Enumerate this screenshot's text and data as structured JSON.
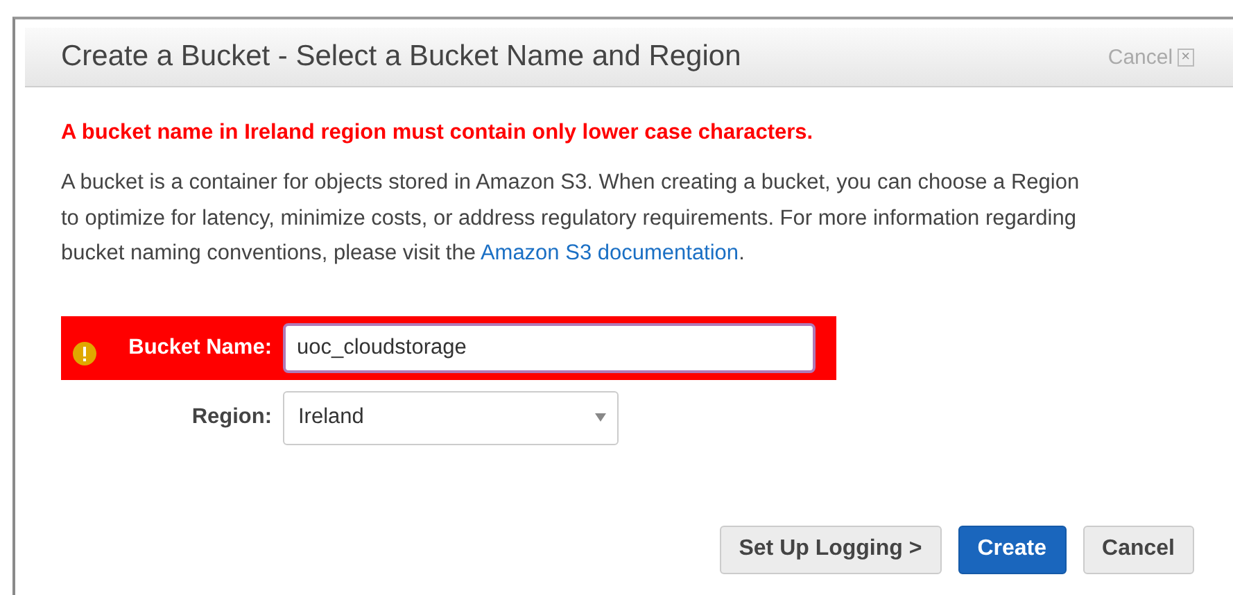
{
  "dialog": {
    "title": "Create a Bucket - Select a Bucket Name and Region",
    "close_label": "Cancel",
    "close_glyph": "×"
  },
  "error_message": "A bucket name in Ireland region must contain only lower case characters.",
  "description": {
    "text": "A bucket is a container for objects stored in Amazon S3. When creating a bucket, you can choose a Region to optimize for latency, minimize costs, or address regulatory requirements. For more information regarding bucket naming conventions, please visit the ",
    "link": "Amazon S3 documentation",
    "after": "."
  },
  "fields": [
    {
      "kind": "text",
      "label": "Bucket Name:",
      "value": "uoc_cloudstorage",
      "error": true
    },
    {
      "kind": "select",
      "label": "Region:",
      "value": "Ireland"
    }
  ],
  "buttons": [
    {
      "label": "Set Up Logging >",
      "kind": "default"
    },
    {
      "label": "Create",
      "kind": "primary"
    },
    {
      "label": "Cancel",
      "kind": "default"
    }
  ]
}
